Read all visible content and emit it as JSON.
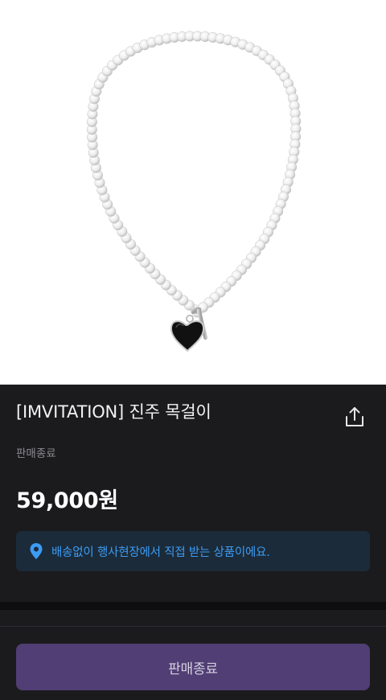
{
  "product": {
    "title": "[IMVITATION] 진주 목걸이",
    "status": "판매종료",
    "price": "59,000원"
  },
  "notice": {
    "text": "배송없이 행사현장에서 직접 받는 상품이에요.",
    "color": "#3d9bf2"
  },
  "footer": {
    "cta_label": "판매종료",
    "cta_color": "#503e74"
  },
  "icons": {
    "share": "share-icon",
    "location": "location-pin-icon"
  }
}
